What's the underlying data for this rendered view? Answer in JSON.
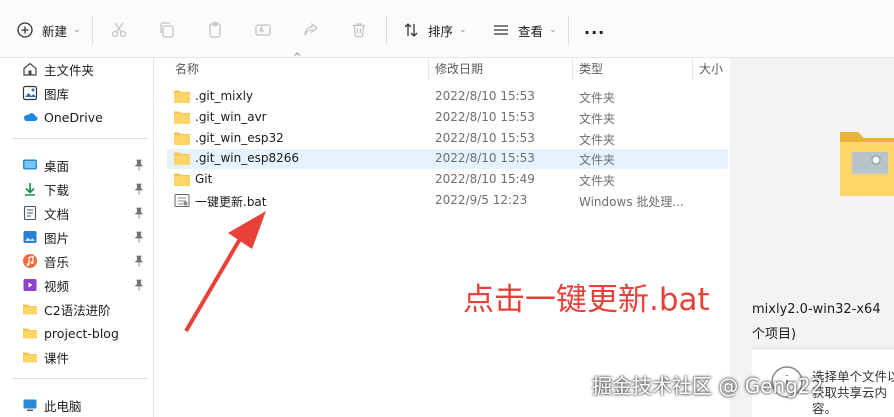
{
  "toolbar": {
    "new_label": "新建",
    "sort_label": "排序",
    "view_label": "查看",
    "more_label": "..."
  },
  "sidebar": {
    "quick": [
      {
        "label": "主文件夹",
        "icon": "home-icon"
      },
      {
        "label": "图库",
        "icon": "gallery-icon"
      },
      {
        "label": "OneDrive",
        "icon": "onedrive-icon"
      }
    ],
    "pinned": [
      {
        "label": "桌面",
        "icon": "desktop-icon"
      },
      {
        "label": "下载",
        "icon": "download-icon"
      },
      {
        "label": "文档",
        "icon": "documents-icon"
      },
      {
        "label": "图片",
        "icon": "pictures-icon"
      },
      {
        "label": "音乐",
        "icon": "music-icon"
      },
      {
        "label": "视频",
        "icon": "videos-icon"
      }
    ],
    "folders": [
      {
        "label": "C2语法进阶",
        "icon": "folder-icon"
      },
      {
        "label": "project-blog",
        "icon": "folder-icon"
      },
      {
        "label": "课件",
        "icon": "folder-icon"
      }
    ],
    "this_pc": "此电脑"
  },
  "columns": {
    "name": "名称",
    "modified": "修改日期",
    "type": "类型",
    "size": "大小"
  },
  "files": [
    {
      "name": ".git_mixly",
      "modified": "2022/8/10 15:53",
      "type": "文件夹",
      "icon": "folder-icon"
    },
    {
      "name": ".git_win_avr",
      "modified": "2022/8/10 15:53",
      "type": "文件夹",
      "icon": "folder-icon"
    },
    {
      "name": ".git_win_esp32",
      "modified": "2022/8/10 15:53",
      "type": "文件夹",
      "icon": "folder-icon"
    },
    {
      "name": ".git_win_esp8266",
      "modified": "2022/8/10 15:53",
      "type": "文件夹",
      "icon": "folder-icon",
      "selected": true
    },
    {
      "name": "Git",
      "modified": "2022/8/10 15:49",
      "type": "文件夹",
      "icon": "folder-icon"
    },
    {
      "name": "一键更新.bat",
      "modified": "2022/9/5 12:23",
      "type": "Windows 批处理...",
      "icon": "batch-file-icon"
    }
  ],
  "preview": {
    "title": "mixly2.0-win32-x64",
    "count": "个项目)",
    "hint": "选择单个文件以获取共享云内容。"
  },
  "annotation": {
    "text": "点击一键更新.bat",
    "color": "#e8413a"
  },
  "watermark": "掘金技术社区 @ Geng22"
}
